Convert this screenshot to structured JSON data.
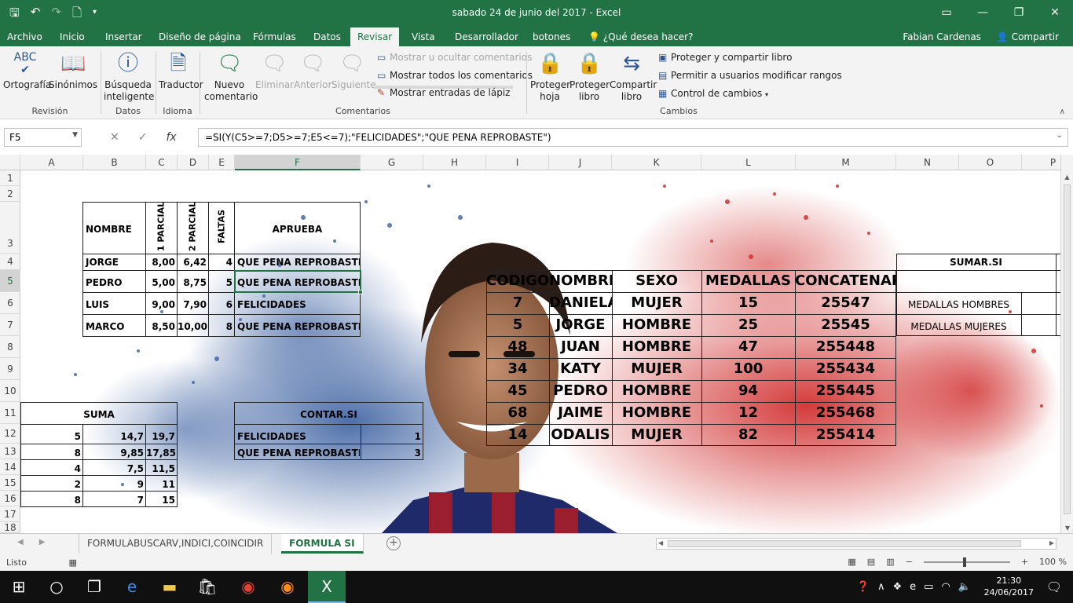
{
  "window": {
    "title": "sabado 24 de junio del 2017 - Excel",
    "user": "Fabian Cardenas",
    "share": "Compartir",
    "tell_me": "¿Qué desea hacer?"
  },
  "tabs": [
    "Archivo",
    "Inicio",
    "Insertar",
    "Diseño de página",
    "Fórmulas",
    "Datos",
    "Revisar",
    "Vista",
    "Desarrollador",
    "botones"
  ],
  "ribbon": {
    "ortografia": "Ortografía",
    "sinonimos": "Sinónimos",
    "revision": "Revisión",
    "busqueda1": "Búsqueda",
    "busqueda2": "inteligente",
    "datos": "Datos",
    "traductor": "Traductor",
    "idioma": "Idioma",
    "nuevo1": "Nuevo",
    "nuevo2": "comentario",
    "eliminar": "Eliminar",
    "anterior": "Anterior",
    "siguiente": "Siguiente",
    "mostrar_ocultar": "Mostrar u ocultar comentarios",
    "mostrar_todos": "Mostrar todos los comentarios",
    "mostrar_lapiz": "Mostrar entradas de lápiz",
    "comentarios": "Comentarios",
    "ph1": "Proteger",
    "ph2": "hoja",
    "pl1": "Proteger",
    "pl2": "libro",
    "cl1": "Compartir",
    "cl2": "libro",
    "proteger_compartir": "Proteger y compartir libro",
    "permitir": "Permitir a usuarios modificar rangos",
    "control": "Control de cambios",
    "cambios": "Cambios"
  },
  "formula_bar": {
    "name_box": "F5",
    "formula": "=SI(Y(C5>=7;D5>=7;E5<=7);\"FELICIDADES\";\"QUE PENA REPROBASTE\")"
  },
  "columns": [
    "A",
    "B",
    "C",
    "D",
    "E",
    "F",
    "G",
    "H",
    "I",
    "J",
    "K",
    "L",
    "M",
    "N",
    "O",
    "P"
  ],
  "rows": [
    "1",
    "2",
    "3",
    "4",
    "5",
    "6",
    "7",
    "8",
    "9",
    "10",
    "11",
    "12",
    "13",
    "14",
    "15",
    "16",
    "17",
    "18"
  ],
  "table1": {
    "headers": {
      "nombre": "NOMBRE",
      "p1": "1 PARCIAL",
      "p2": "2 PARCIAL",
      "faltas": "FALTAS",
      "aprueba": "APRUEBA"
    },
    "rows": [
      {
        "nombre": "JORGE",
        "p1": "8,00",
        "p2": "6,42",
        "faltas": "4",
        "aprueba": "QUE PENA REPROBASTE"
      },
      {
        "nombre": "PEDRO",
        "p1": "5,00",
        "p2": "8,75",
        "faltas": "5",
        "aprueba": "QUE PENA REPROBASTE"
      },
      {
        "nombre": "LUIS",
        "p1": "9,00",
        "p2": "7,90",
        "faltas": "6",
        "aprueba": "FELICIDADES"
      },
      {
        "nombre": "MARCO",
        "p1": "8,50",
        "p2": "10,00",
        "faltas": "8",
        "aprueba": "QUE PENA REPROBASTE"
      }
    ]
  },
  "suma": {
    "title": "SUMA",
    "rows": [
      [
        "5",
        "14,7",
        "19,7"
      ],
      [
        "8",
        "9,85",
        "17,85"
      ],
      [
        "4",
        "7,5",
        "11,5"
      ],
      [
        "2",
        "9",
        "11"
      ],
      [
        "8",
        "7",
        "15"
      ]
    ]
  },
  "contar": {
    "title": "CONTAR.SI",
    "rows": [
      [
        "FELICIDADES",
        "1"
      ],
      [
        "QUE PENA REPROBASTE",
        "3"
      ]
    ]
  },
  "table2": {
    "headers": [
      "CODIGO",
      "NOMBRE",
      "SEXO",
      "MEDALLAS",
      "CONCATENAR"
    ],
    "rows": [
      [
        "7",
        "DANIELA",
        "MUJER",
        "15",
        "25547"
      ],
      [
        "5",
        "JORGE",
        "HOMBRE",
        "25",
        "25545"
      ],
      [
        "48",
        "JUAN",
        "HOMBRE",
        "47",
        "255448"
      ],
      [
        "34",
        "KATY",
        "MUJER",
        "100",
        "255434"
      ],
      [
        "45",
        "PEDRO",
        "HOMBRE",
        "94",
        "255445"
      ],
      [
        "68",
        "JAIME",
        "HOMBRE",
        "12",
        "255468"
      ],
      [
        "14",
        "ODALIS",
        "MUJER",
        "82",
        "255414"
      ]
    ]
  },
  "sumar_si": {
    "title": "SUMAR.SI",
    "hombres": "MEDALLAS HOMBRES",
    "mujeres": "MEDALLAS MUJERES"
  },
  "sheets": [
    "FORMULABUSCARV,INDICI,COINCIDIR",
    "FORMULA SI"
  ],
  "status": {
    "ready": "Listo",
    "zoom": "100 %"
  },
  "taskbar": {
    "time": "21:30",
    "date": "24/06/2017"
  },
  "colors": {
    "excel_green": "#217346",
    "blue_splash": "#3a5fa0",
    "red_splash": "#d23030"
  }
}
